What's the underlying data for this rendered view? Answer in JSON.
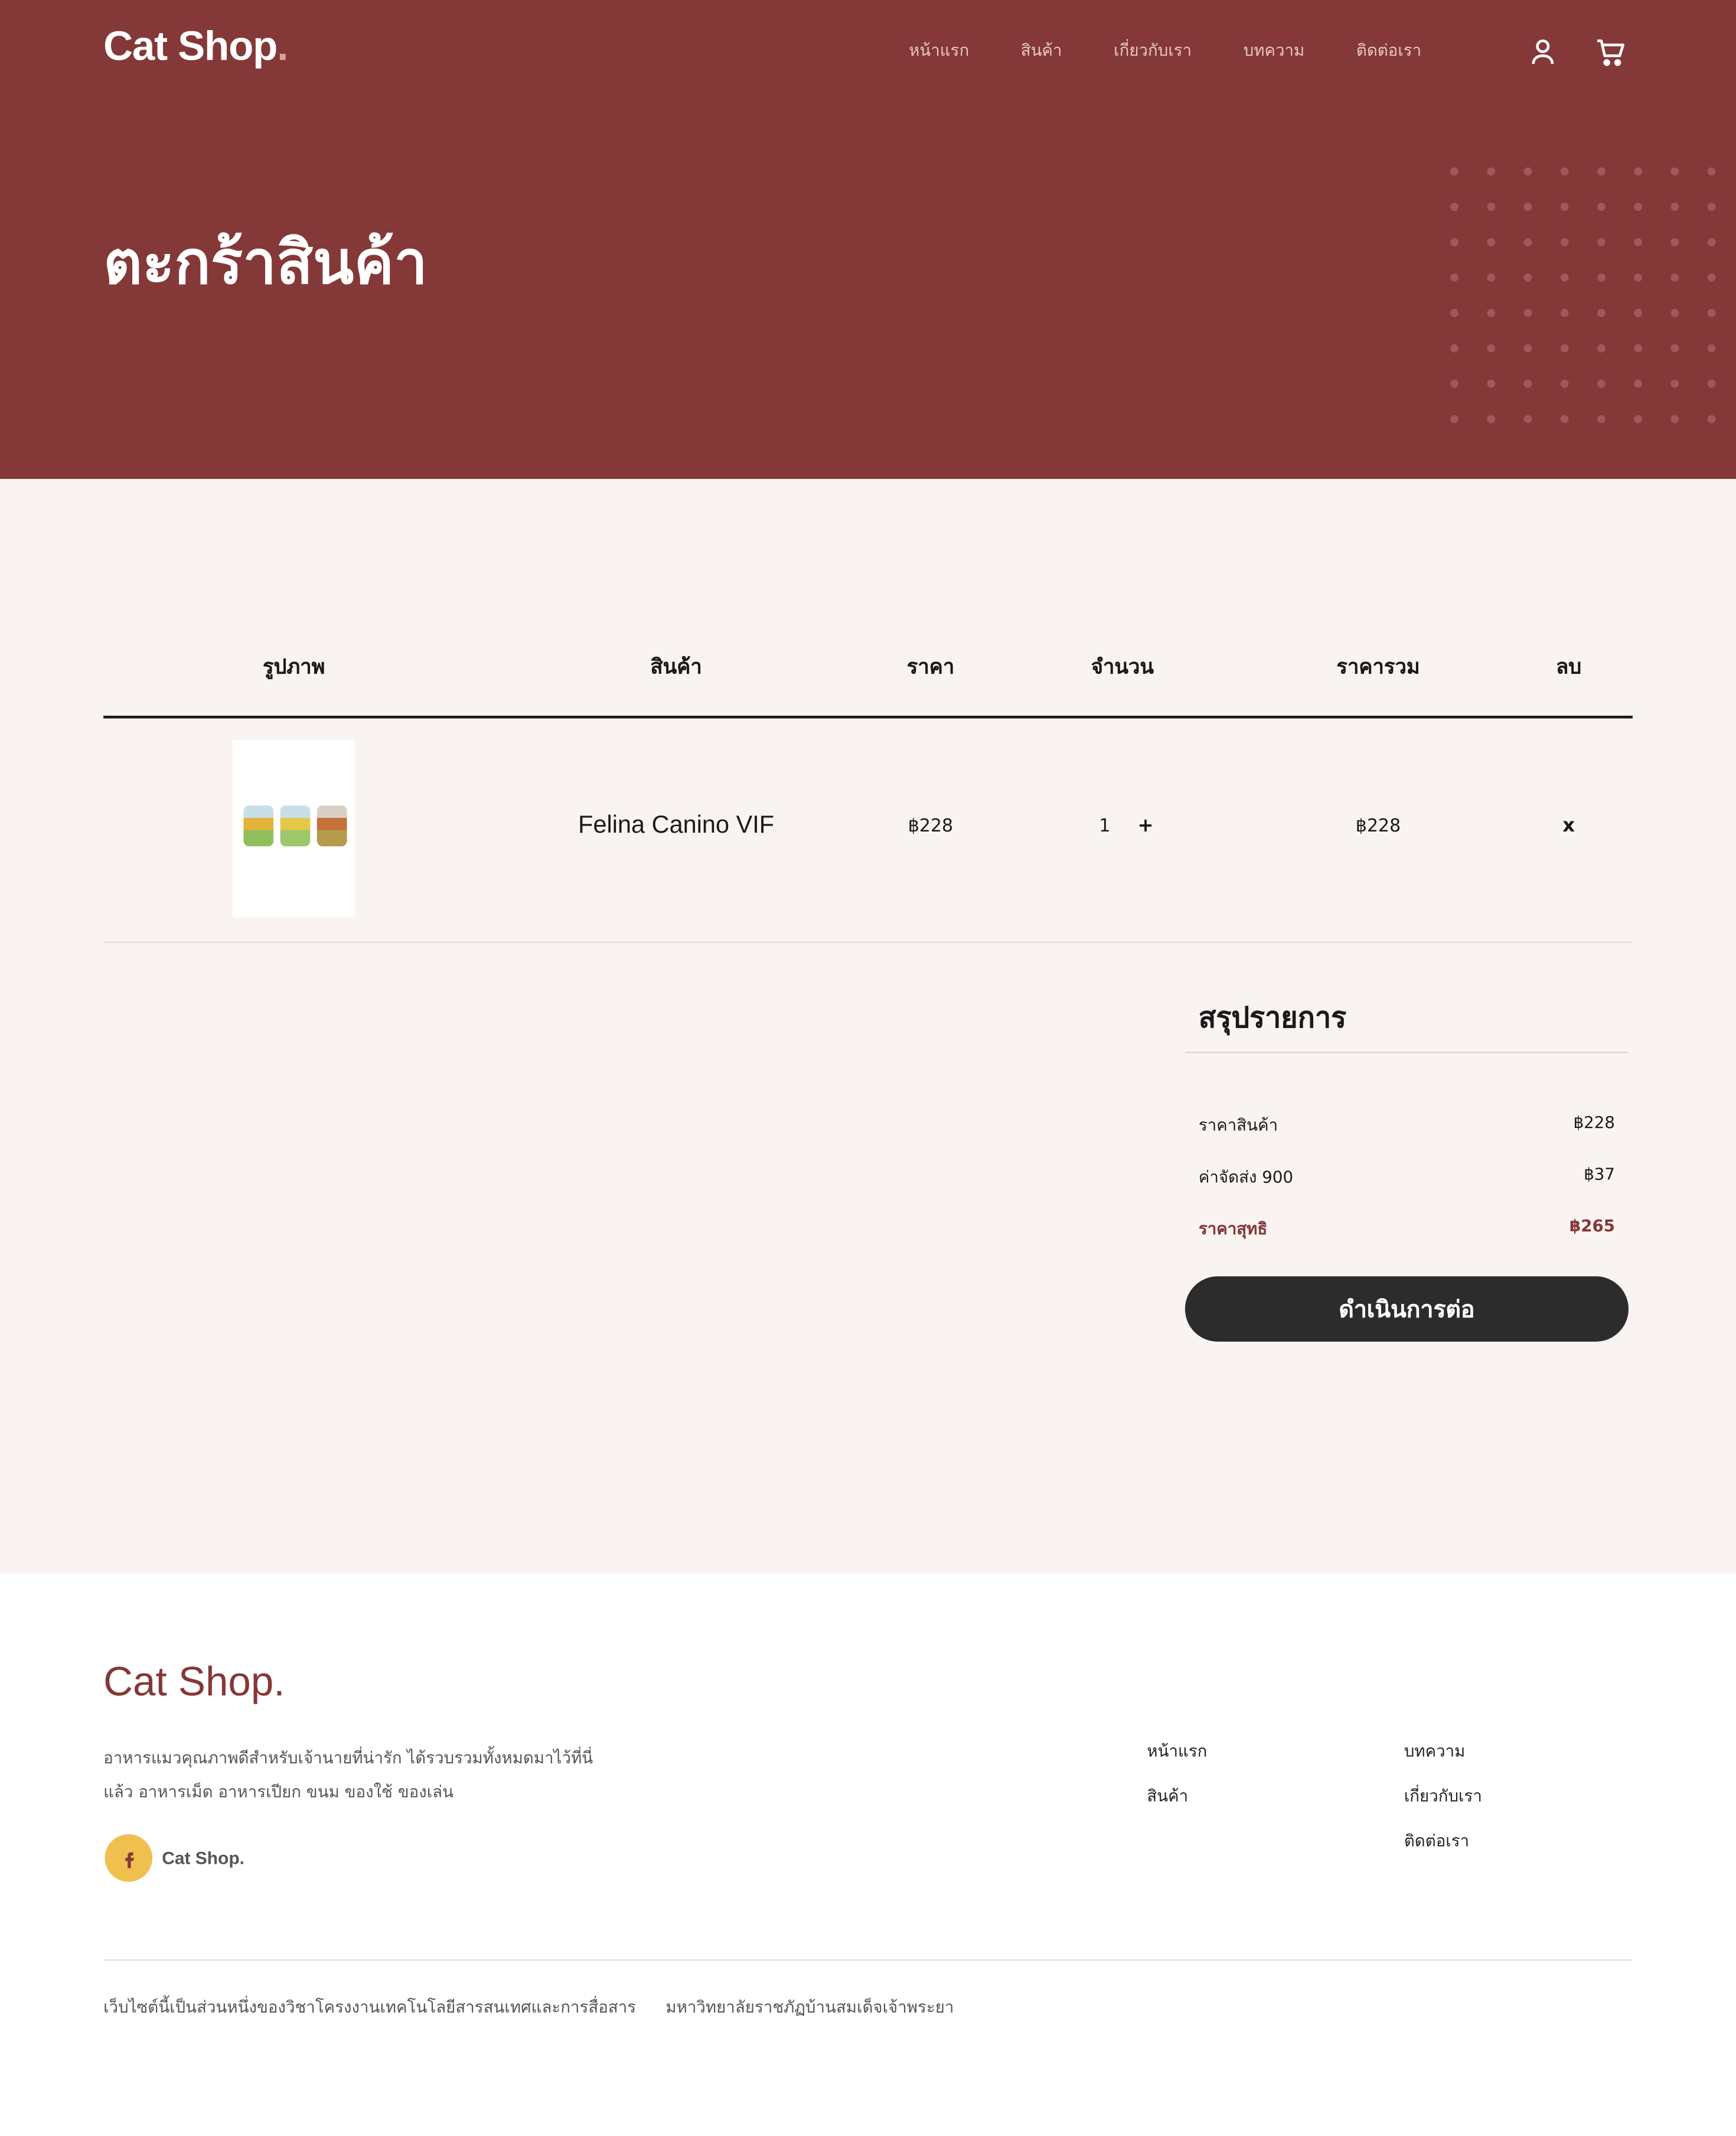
{
  "header": {
    "logo": "Cat Shop",
    "logo_dot": ".",
    "nav": [
      "หน้าแรก",
      "สินค้า",
      "เกี่ยวกับเรา",
      "บทความ",
      "ติดต่อเรา"
    ],
    "icons": [
      "user-icon",
      "cart-icon"
    ]
  },
  "hero": {
    "title": "ตะกร้าสินค้า"
  },
  "cart": {
    "columns": [
      "รูปภาพ",
      "สินค้า",
      "ราคา",
      "จำนวน",
      "ราคารวม",
      "ลบ"
    ],
    "items": [
      {
        "name": "Felina Canino VIF",
        "price": "฿228",
        "qty": "1",
        "plus": "+",
        "total": "฿228",
        "remove": "x"
      }
    ]
  },
  "summary": {
    "title": "สรุปรายการ",
    "subtotal_label": "ราคาสินค้า",
    "subtotal": "฿228",
    "shipping_label": "ค่าจัดส่ง 900",
    "shipping": "฿37",
    "net_label": "ราคาสุทธิ",
    "net": "฿265",
    "checkout_label": "ดำเนินการต่อ",
    "accent": "#843837"
  },
  "footer": {
    "logo": "Cat Shop.",
    "description": "อาหารแมวคุณภาพดีสำหรับเจ้านายที่น่ารัก ได้รวบรวมทั้งหมดมาไว้ที่นี่แล้ว อาหารเม็ด อาหารเปียก ขนม ของใช้ ของเล่น",
    "social_label": "Cat Shop.",
    "col1": [
      "หน้าแรก",
      "สินค้า"
    ],
    "col2": [
      "บทความ",
      "เกี่ยวกับเรา",
      "ติดต่อเรา"
    ],
    "bottom": [
      "เว็บไซต์นี้เป็นส่วนหนึ่งของวิชาโครงงานเทคโนโลยีสารสนเทศและการสื่อสาร",
      "มหาวิทยาลัยราชภัฏบ้านสมเด็จเจ้าพระยา"
    ]
  }
}
